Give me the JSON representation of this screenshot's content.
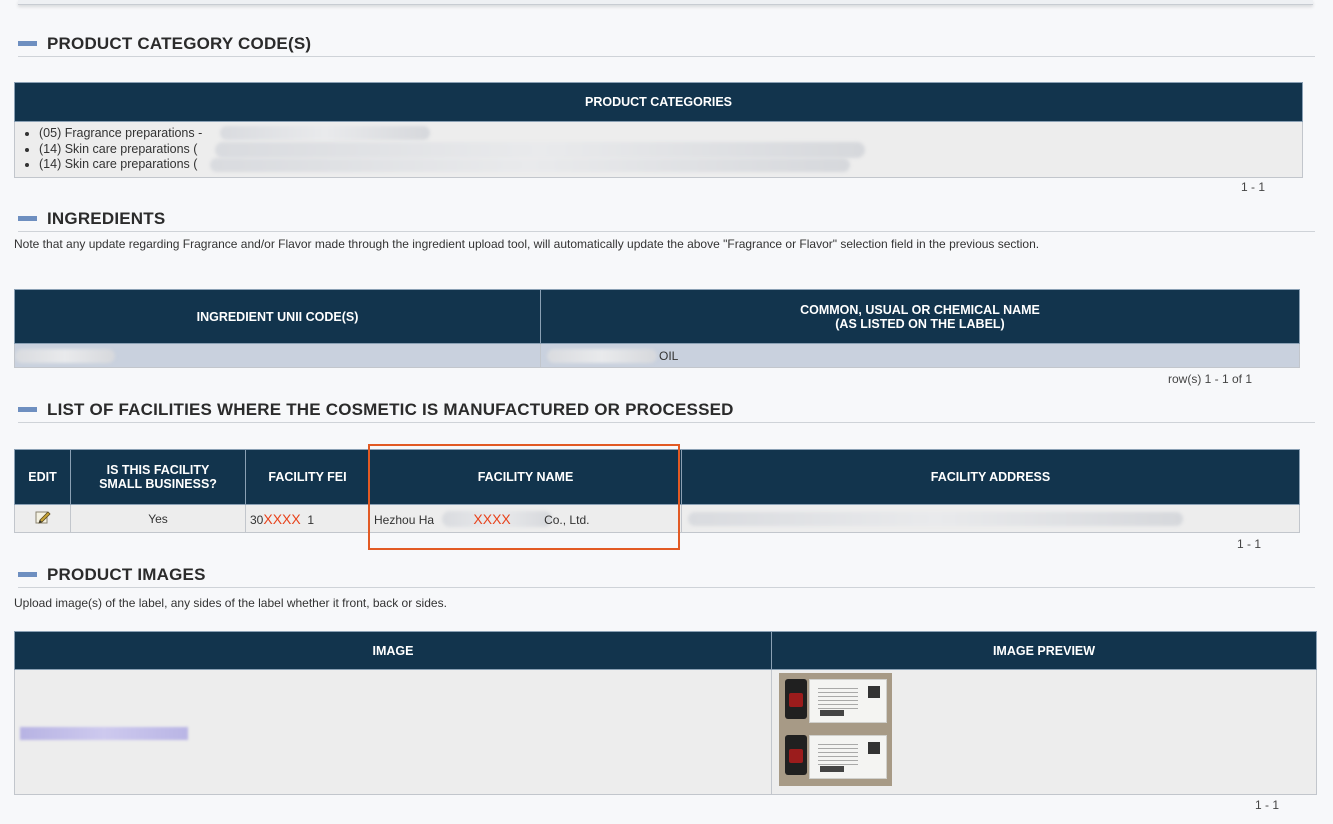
{
  "sections": {
    "categories": {
      "title": "PRODUCT CATEGORY CODE(S)",
      "header": "PRODUCT CATEGORIES",
      "items": [
        "(05) Fragrance preparations -",
        "(14) Skin care preparations (",
        "(14) Skin care preparations ("
      ],
      "pager": "1 - 1"
    },
    "ingredients": {
      "title": "INGREDIENTS",
      "note": "Note that any update regarding Fragrance and/or Flavor made through the ingredient upload tool, will automatically update the above \"Fragrance or Flavor\" selection field in the previous section.",
      "headers": {
        "unii": "INGREDIENT UNII CODE(S)",
        "name_line1": "COMMON, USUAL OR CHEMICAL NAME",
        "name_line2": "(AS LISTED ON THE LABEL)"
      },
      "row": {
        "unii": "",
        "name": "OIL"
      },
      "pager": "row(s) 1 - 1 of 1"
    },
    "facilities": {
      "title": "LIST OF FACILITIES WHERE THE COSMETIC IS MANUFACTURED OR PROCESSED",
      "headers": {
        "edit": "EDIT",
        "small_line1": "IS THIS FACILITY",
        "small_line2": "SMALL BUSINESS?",
        "fei": "FACILITY FEI",
        "name": "FACILITY NAME",
        "address": "FACILITY ADDRESS"
      },
      "row": {
        "small_business": "Yes",
        "fei_prefix": "30",
        "fei_mask": "XXXX",
        "fei_suffix": "1",
        "name_prefix": "Hezhou Ha",
        "name_mask": "XXXX",
        "name_suffix": "Co., Ltd."
      },
      "pager": "1 - 1"
    },
    "images": {
      "title": "PRODUCT IMAGES",
      "note": "Upload image(s) of the label, any sides of the label whether it front, back or sides.",
      "headers": {
        "image": "IMAGE",
        "preview": "IMAGE PREVIEW"
      },
      "pager": "1 - 1"
    }
  },
  "colors": {
    "header_bg": "#12344d",
    "highlight": "#e25a24",
    "mask_red": "#e8431c",
    "section_dash": "#6e8fc0"
  }
}
